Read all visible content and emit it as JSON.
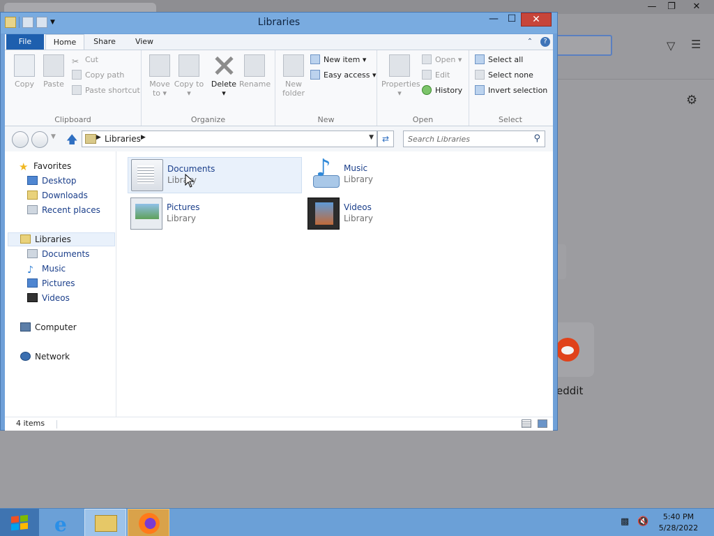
{
  "background_browser": {
    "site_label": "eddit",
    "window_controls": [
      "—",
      "❐",
      "✕"
    ]
  },
  "window": {
    "title": "Libraries",
    "controls": {
      "minimize": "—",
      "maximize": "☐",
      "close": "✕"
    }
  },
  "ribbon": {
    "tabs": [
      {
        "label": "File"
      },
      {
        "label": "Home"
      },
      {
        "label": "Share"
      },
      {
        "label": "View"
      }
    ],
    "groups": {
      "clipboard": {
        "label": "Clipboard",
        "copy": "Copy",
        "paste": "Paste",
        "cut": "Cut",
        "copy_path": "Copy path",
        "paste_shortcut": "Paste shortcut"
      },
      "organize": {
        "label": "Organize",
        "move_to": "Move to ▾",
        "copy_to": "Copy to ▾",
        "delete": "Delete ▾",
        "rename": "Rename"
      },
      "new": {
        "label": "New",
        "new_folder": "New folder",
        "new_item": "New item ▾",
        "easy_access": "Easy access ▾"
      },
      "open": {
        "label": "Open",
        "properties": "Properties ▾",
        "open": "Open ▾",
        "edit": "Edit",
        "history": "History"
      },
      "select": {
        "label": "Select",
        "select_all": "Select all",
        "select_none": "Select none",
        "invert_selection": "Invert selection"
      }
    }
  },
  "address_bar": {
    "crumb": "Libraries",
    "search_placeholder": "Search Libraries"
  },
  "nav_pane": {
    "favorites": {
      "label": "Favorites",
      "items": [
        "Desktop",
        "Downloads",
        "Recent places"
      ]
    },
    "libraries": {
      "label": "Libraries",
      "items": [
        "Documents",
        "Music",
        "Pictures",
        "Videos"
      ]
    },
    "computer": "Computer",
    "network": "Network"
  },
  "items": [
    {
      "name": "Documents",
      "type": "Library"
    },
    {
      "name": "Music",
      "type": "Library"
    },
    {
      "name": "Pictures",
      "type": "Library"
    },
    {
      "name": "Videos",
      "type": "Library"
    }
  ],
  "status": {
    "count": "4 items"
  },
  "taskbar": {
    "time": "5:40 PM",
    "date": "5/28/2022"
  },
  "colors": {
    "window_frame": "#6fa0d8",
    "file_tab": "#1e5fae",
    "taskbar": "#6ba0d7",
    "close_button": "#c7453a"
  }
}
